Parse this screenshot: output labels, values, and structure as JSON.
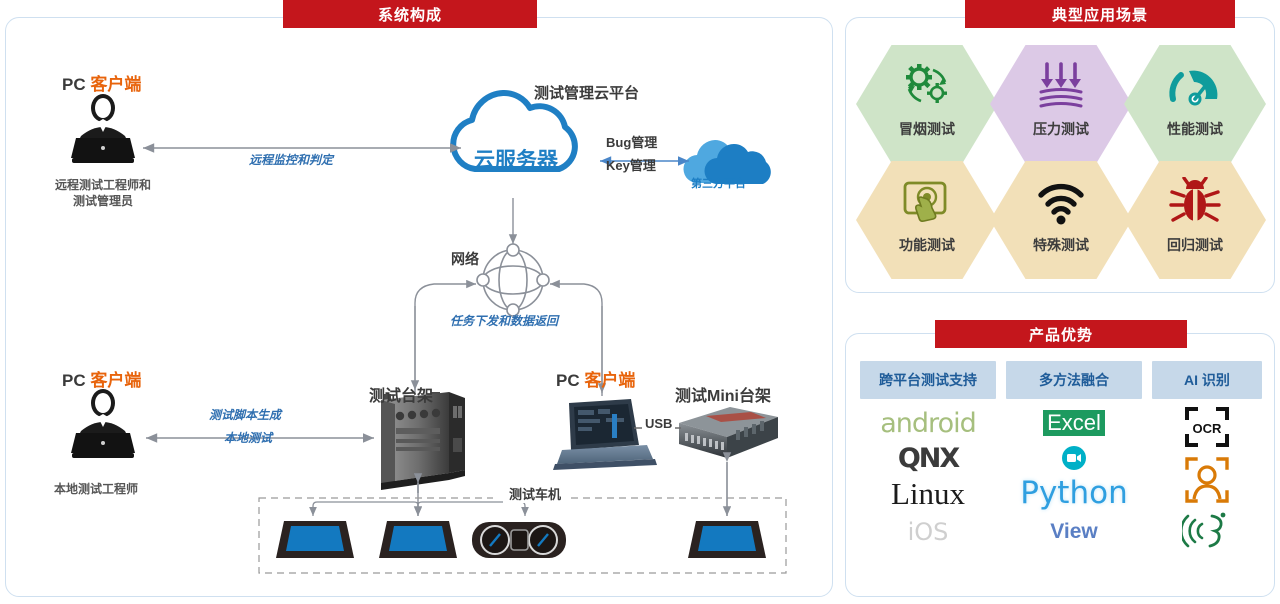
{
  "panels": {
    "system": {
      "title": "系统构成"
    },
    "scenarios": {
      "title": "典型应用场景"
    },
    "advantages": {
      "title": "产品优势"
    }
  },
  "system": {
    "nodes": {
      "remote_pc_title_prefix": "PC ",
      "remote_pc_title_suffix": "客户端",
      "remote_pc_caption_line1": "远程测试工程师和",
      "remote_pc_caption_line2": "测试管理员",
      "cloud_platform_title": "测试管理云平台",
      "cloud_server_label": "云服务器",
      "third_party_label": "第三方平台",
      "network_label": "网络",
      "bench_label": "测试台架",
      "local_pc_title_prefix": "PC ",
      "local_pc_title_suffix": "客户端",
      "local_pc_caption": "本地测试工程师",
      "mid_pc_title_prefix": "PC ",
      "mid_pc_title_suffix": "客户端",
      "mini_bench_label": "测试Mini台架",
      "vehicle_group_label": "测试车机"
    },
    "edges": {
      "remote_monitor": "远程监控和判定",
      "bug_manage": "Bug管理",
      "key_manage": "Key管理",
      "task_dispatch": "任务下发和数据返回",
      "script_gen": "测试脚本生成",
      "local_test": "本地测试",
      "usb": "USB"
    }
  },
  "scenarios": [
    {
      "label": "冒烟测试",
      "icon": "gears-refresh-icon",
      "fill": "#cfe4c8",
      "accent": "#1f8a3b"
    },
    {
      "label": "压力测试",
      "icon": "down-arrows-icon",
      "fill": "#dcc9e6",
      "accent": "#7b3f9e"
    },
    {
      "label": "性能测试",
      "icon": "gauge-icon",
      "fill": "#cfe4c8",
      "accent": "#0f9c9c"
    },
    {
      "label": "功能测试",
      "icon": "touch-screen-icon",
      "fill": "#f2e0b8",
      "accent": "#7f8b28"
    },
    {
      "label": "特殊测试",
      "icon": "wifi-icon",
      "fill": "#f2e0b8",
      "accent": "#111111"
    },
    {
      "label": "回归测试",
      "icon": "bug-icon",
      "fill": "#f2e0b8",
      "accent": "#b01717"
    }
  ],
  "advantages": {
    "columns": [
      {
        "header": "跨平台测试支持",
        "items": [
          "android",
          "QNX",
          "Linux",
          "iOS"
        ]
      },
      {
        "header": "多方法融合",
        "items": [
          "Excel",
          "Camera",
          "Python",
          "View"
        ]
      },
      {
        "header": "AI 识别",
        "items": [
          "OCR",
          "face-recognition-icon",
          "voice-recognition-icon"
        ]
      }
    ],
    "logo_text": {
      "android": "android",
      "qnx": "QNX",
      "linux": "Linux",
      "ios": "iOS",
      "excel": "Excel",
      "python": "Python",
      "view": "View",
      "ocr": "OCR"
    }
  },
  "colors": {
    "banner_red": "#c4161c",
    "panel_border": "#cfe0f0",
    "orange_accent": "#e8640c",
    "blue_italic": "#2f6fb0",
    "cloud_blue": "#1f7fc4",
    "screen_blue": "#1379c0"
  }
}
